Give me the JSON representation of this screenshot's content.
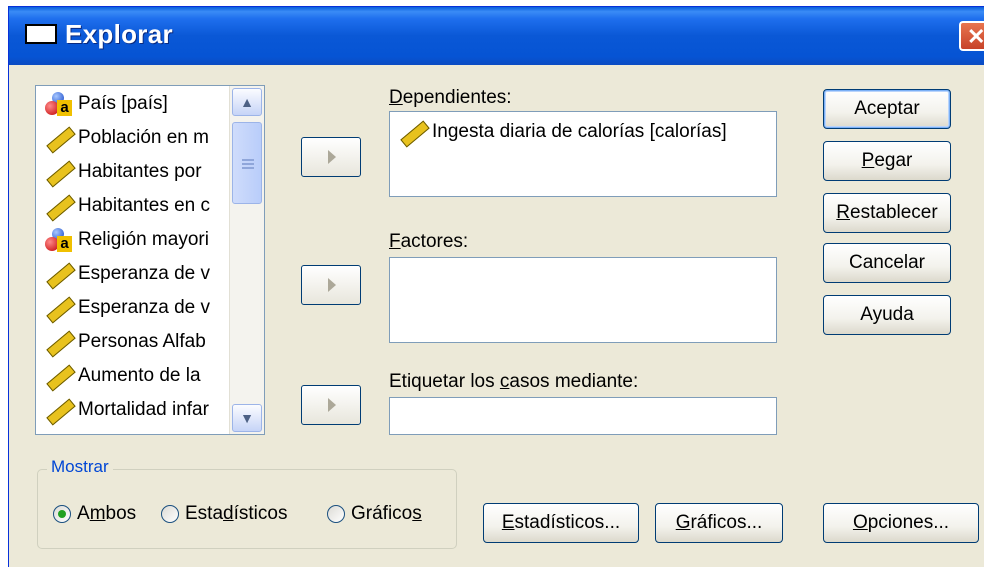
{
  "window": {
    "title": "Explorar",
    "close_glyph": "✕"
  },
  "variables": [
    {
      "label": "País [país]",
      "icon": "nominal-icon"
    },
    {
      "label": "Población en m",
      "icon": "scale-icon"
    },
    {
      "label": "Habitantes por",
      "icon": "scale-icon"
    },
    {
      "label": "Habitantes en c",
      "icon": "scale-icon"
    },
    {
      "label": "Religión mayori",
      "icon": "nominal-icon"
    },
    {
      "label": "Esperanza de v",
      "icon": "scale-icon"
    },
    {
      "label": "Esperanza de v",
      "icon": "scale-icon"
    },
    {
      "label": "Personas Alfab",
      "icon": "scale-icon"
    },
    {
      "label": "Aumento de la",
      "icon": "scale-icon"
    },
    {
      "label": "Mortalidad infar",
      "icon": "scale-icon"
    }
  ],
  "dependents": {
    "label_pre": "",
    "label_u": "D",
    "label_post": "ependientes:",
    "items": [
      {
        "label": "Ingesta diaria de calorías [calorías]",
        "icon": "scale-icon"
      }
    ]
  },
  "factors": {
    "label_u": "F",
    "label_post": "actores:"
  },
  "label_cases": {
    "label_pre": "Etiquetar los ",
    "label_u": "c",
    "label_post": "asos mediante:"
  },
  "buttons": {
    "accept": "Aceptar",
    "paste_u": "P",
    "paste_rest": "egar",
    "reset_u": "R",
    "reset_rest": "establecer",
    "cancel": "Cancelar",
    "help": "Ayuda",
    "stats_u": "E",
    "stats_rest": "stadísticos...",
    "plots_u": "G",
    "plots_rest": "ráficos...",
    "options_u": "O",
    "options_rest": "pciones..."
  },
  "display": {
    "legend": "Mostrar",
    "both_pre": "A",
    "both_u": "m",
    "both_post": "bos",
    "stats_pre": "Esta",
    "stats_u": "d",
    "stats_post": "ísticos",
    "plots_pre": "Gráfico",
    "plots_u": "s",
    "plots_post": "",
    "selected": "Ambos"
  }
}
